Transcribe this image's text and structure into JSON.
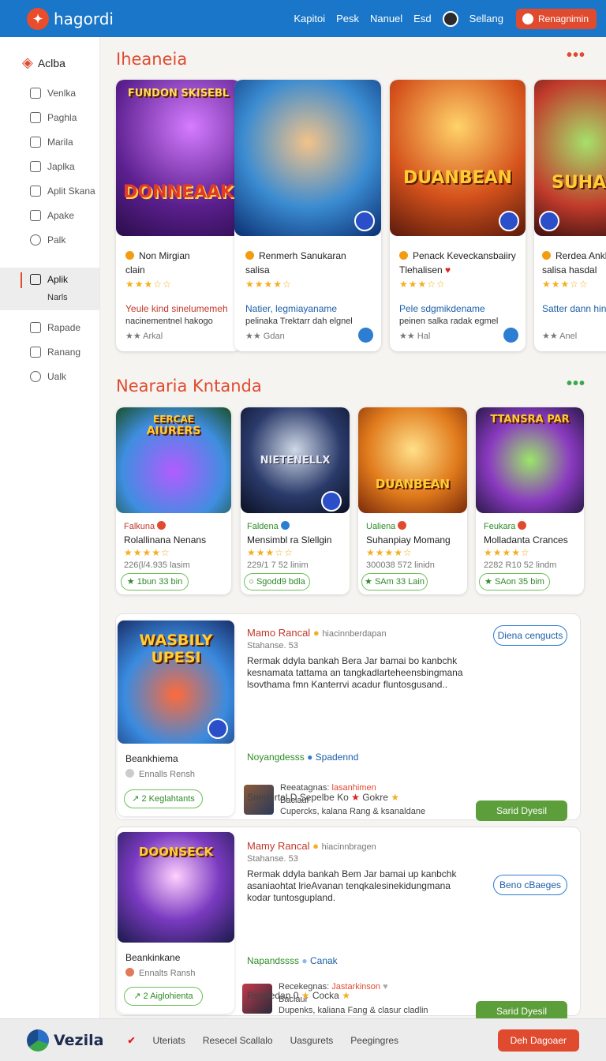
{
  "topbar": {
    "logo_text": "hagordi",
    "nav": [
      "Kapitoi",
      "Pesk",
      "Nanuel",
      "Esd"
    ],
    "user_label": "Sellang",
    "action_label": "Renagnimin"
  },
  "sidebar": {
    "brand": "Aclba",
    "items": [
      {
        "label": "Venlka",
        "icon": "pencil-icon"
      },
      {
        "label": "Paghla",
        "icon": "image-icon"
      },
      {
        "label": "Marila",
        "icon": "home-icon"
      },
      {
        "label": "Japlka",
        "icon": "document-icon"
      },
      {
        "label": "Aplit Skana",
        "icon": "bus-icon"
      },
      {
        "label": "Apake",
        "icon": "square-icon"
      },
      {
        "label": "Palk",
        "icon": "bubble-icon"
      }
    ],
    "active": {
      "label": "Aplik",
      "sub": "Narls",
      "icon": "tag-icon"
    },
    "items2": [
      {
        "label": "Rapade",
        "icon": "pencil-icon"
      },
      {
        "label": "Ranang",
        "icon": "heart-icon"
      },
      {
        "label": "Ualk",
        "icon": "circle-icon"
      }
    ]
  },
  "section1": {
    "title": "Iheaneia",
    "cards": [
      {
        "art_label": "DONNEAAK",
        "art_top": "FUNDON SKISEBL",
        "title": "Non Mirgian",
        "sub": "clain",
        "stars": 3.5,
        "desc": "Yeule kind sinelumemeh",
        "desc2": "nacinementnel hakogo",
        "meta": "Arkal",
        "desc_color": "#c0392b"
      },
      {
        "art_label": "",
        "art_top": "",
        "title": "Renmerh Sanukaran",
        "sub": "salisa",
        "stars": 4,
        "desc": "Natier, legmiayaname",
        "desc2": "pelinaka Trektarr dah elgnel",
        "meta": "Gdan",
        "desc_color": "#1d5fa8"
      },
      {
        "art_label": "DUANBEAN",
        "art_top": "",
        "title": "Penack Keveckansbaiiry",
        "sub": "Tlehalisen",
        "stars": 3.5,
        "desc": "Pele sdgmikdename",
        "desc2": "peinen salka radak egmel",
        "meta": "Hal",
        "desc_color": "#1d5fa8"
      },
      {
        "art_label": "SUHAN",
        "art_top": "",
        "title": "Rerdea Ankl",
        "sub": "salisa hasdal",
        "stars": 3.5,
        "desc": "Satter dann hin",
        "desc2": "",
        "meta": "Anel",
        "desc_color": "#1d5fa8"
      }
    ]
  },
  "section2": {
    "title": "Neararia Kntanda",
    "cards": [
      {
        "art_label": "AIURERS",
        "art_top": "EERCAE",
        "tag": "Falkuna",
        "title": "Rolallinana Nenans",
        "stars": 4,
        "meta": "226(l/4.935 lasim",
        "pill": "1bun 33 bin"
      },
      {
        "art_label": "NIETENELLX",
        "art_top": "",
        "tag": "Faldena",
        "title": "Mensimbl ra Slellgin",
        "stars": 3.5,
        "meta": "229/1 7 52 linim",
        "pill": "Sgodd9 bdla"
      },
      {
        "art_label": "DUANBEAN",
        "art_top": "",
        "tag": "Ualiena",
        "title": "Suhanpiay Momang",
        "stars": 4,
        "meta": "300038 572 linidn",
        "pill": "SAm 33 Lain"
      },
      {
        "art_label": "TTANSRA PAR",
        "art_top": "",
        "tag": "Feukara",
        "title": "Molladanta Crances",
        "stars": 4,
        "meta": "2282 R10 52 lindm",
        "pill": "SAon 35 bim"
      }
    ]
  },
  "features": [
    {
      "art_label": "WASBILY UPESI",
      "left_title": "Beankhiema",
      "left_sub": "Ennalls Rensh",
      "left_pill": "2 Keglahtants",
      "name": "Mamo Rancal",
      "name_meta": "hiacinnberdapan",
      "handle": "Stahanse. 53",
      "text": "Rermak ddyla bankah Bera Jar bamai bo kanbchk kesnamata tattama an tangkadlarteheensbingmana lsovthama fmn Kanterrvi acadur fluntosgusand..",
      "link": "Noyangdesss",
      "link2": "Spadennd",
      "right_btn": "Diena cengucts",
      "comment_name": "Reeatagnas:",
      "comment_tag": "lasanhimen",
      "comment_sub": "Baclaur",
      "comment_text": "Cupercks, kalana Rang & ksanaldane",
      "green_btn": "Sarid Dyesil",
      "footer": "Snedertal D  Sepelbe  Ko",
      "footer2": "Gokre"
    },
    {
      "art_label": "DOONSECK",
      "left_title": "Beankinkane",
      "left_sub": "Ennalts Ransh",
      "left_pill": "2 Aiglohienta",
      "name": "Mamy Rancal",
      "name_meta": "hiacinnbragen",
      "handle": "Stahanse. 53",
      "text": "Rermak ddyla bankah Bem Jar bamai up kanbchk asaniaohtat lrieAvanan tenqkalesinekidungmana kodar tuntosgupland.",
      "link": "Napandssss",
      "link2": "Canak",
      "right_btn": "Beno cBaeges",
      "comment_name": "Recekegnas:",
      "comment_tag": "Jastarkinson",
      "comment_sub": "Baclaur",
      "comment_text": "Dupenks, kaliana Fang & clasur cladlin",
      "green_btn": "Sarid Dyesil",
      "footer": "Roadedan 0",
      "footer2": "Cocka"
    }
  ],
  "bottombar": {
    "brand": "Vezila",
    "nav": [
      "Uteriats",
      "Resecel Scallalo",
      "Uasgurets",
      "Peegingres"
    ],
    "button": "Deh Dagoaer"
  }
}
